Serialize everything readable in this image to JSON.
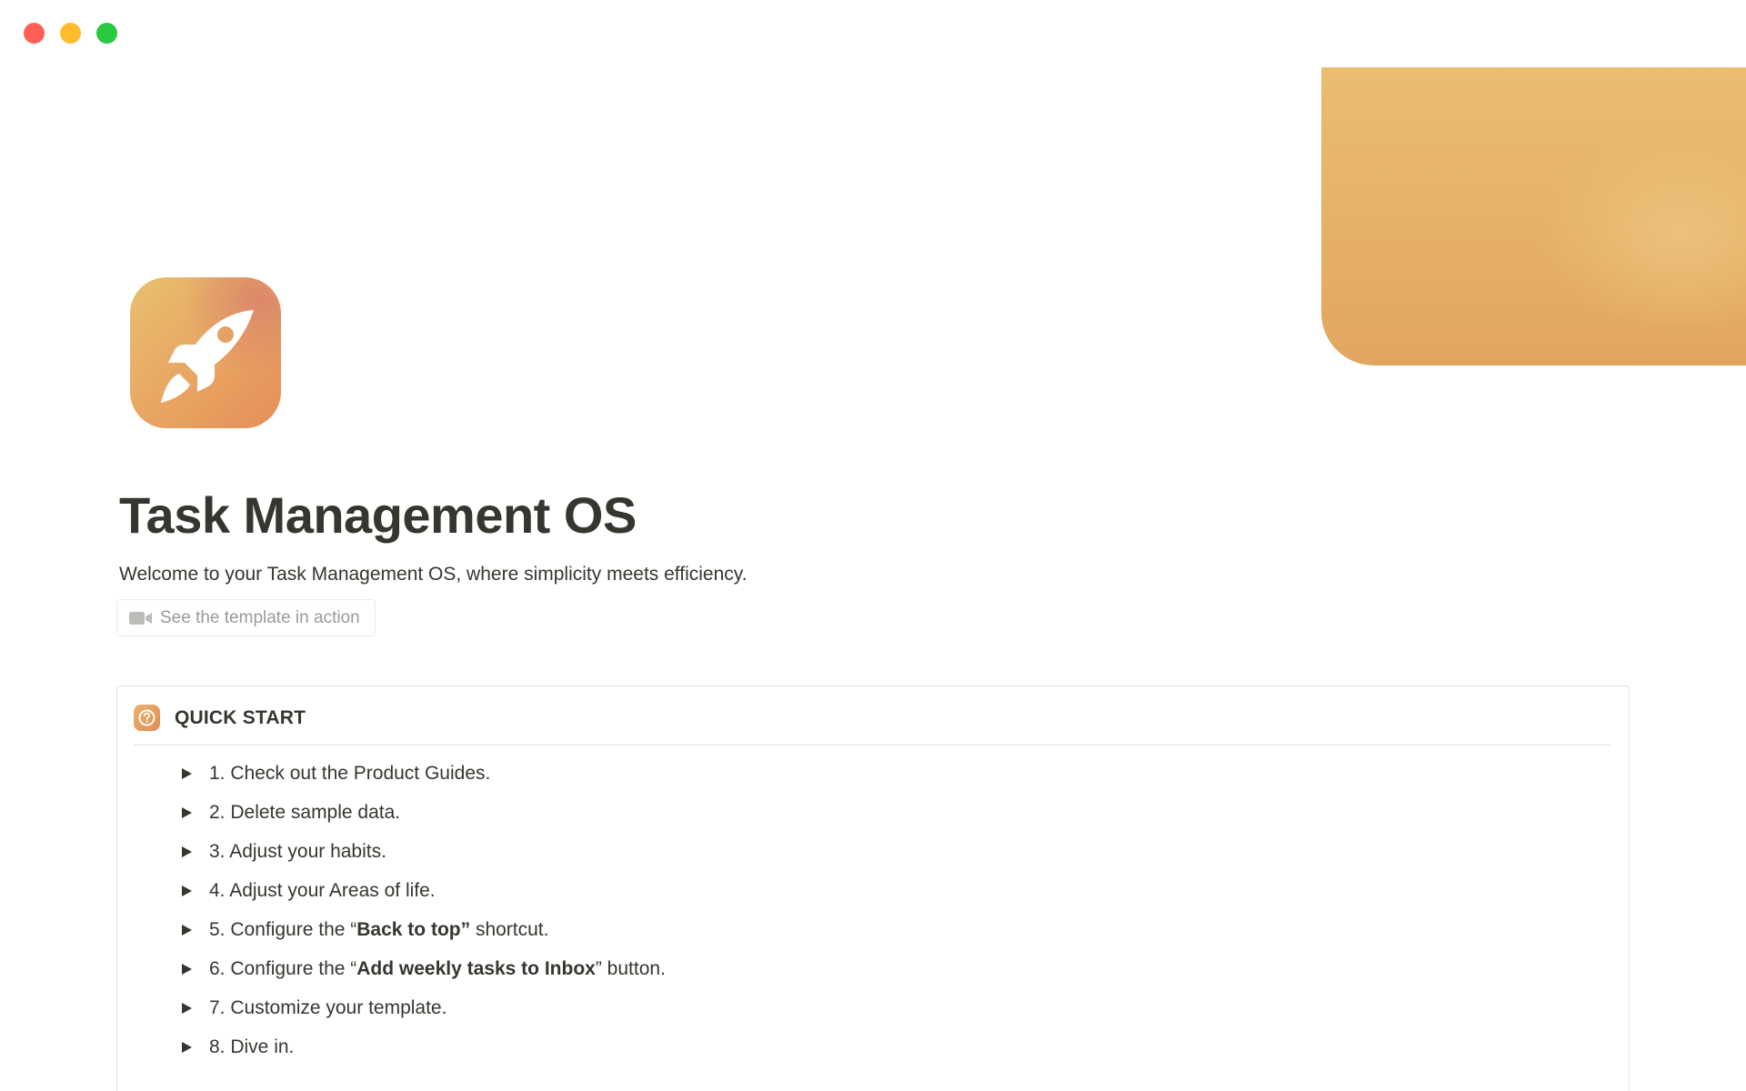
{
  "window": {
    "traffic_lights": [
      {
        "name": "close",
        "color": "#ff5f57"
      },
      {
        "name": "minimize",
        "color": "#febc2e"
      },
      {
        "name": "zoom",
        "color": "#28c840"
      }
    ]
  },
  "colors": {
    "cover_light": "#e9bd72",
    "cover_dark": "#e2a55f",
    "icon_gradient_start": "#e8c06f",
    "icon_gradient_end": "#e58f58",
    "text": "#37352f",
    "muted_text": "#9b9a97",
    "border": "#e3e2e0"
  },
  "page": {
    "icon": "rocket-icon",
    "title": "Task Management OS",
    "subtitle": "Welcome to your Task Management OS, where simplicity meets efficiency.",
    "video_button": {
      "icon": "video-camera-icon",
      "label": "See the template in action"
    }
  },
  "quick_start": {
    "icon": "question-mark-icon",
    "title": "QUICK START",
    "items": [
      {
        "pre": "1. Check out the Product Guides.",
        "bold": "",
        "post": ""
      },
      {
        "pre": "2. Delete sample data.",
        "bold": "",
        "post": ""
      },
      {
        "pre": "3. Adjust your habits.",
        "bold": "",
        "post": ""
      },
      {
        "pre": "4. Adjust your Areas of life.",
        "bold": "",
        "post": ""
      },
      {
        "pre": "5. Configure the “",
        "bold": "Back to top”",
        "post": " shortcut."
      },
      {
        "pre": "6. Configure the “",
        "bold": "Add weekly tasks to Inbox",
        "post": "” button."
      },
      {
        "pre": "7. Customize your template.",
        "bold": "",
        "post": ""
      },
      {
        "pre": "8. Dive in.",
        "bold": "",
        "post": ""
      }
    ]
  }
}
